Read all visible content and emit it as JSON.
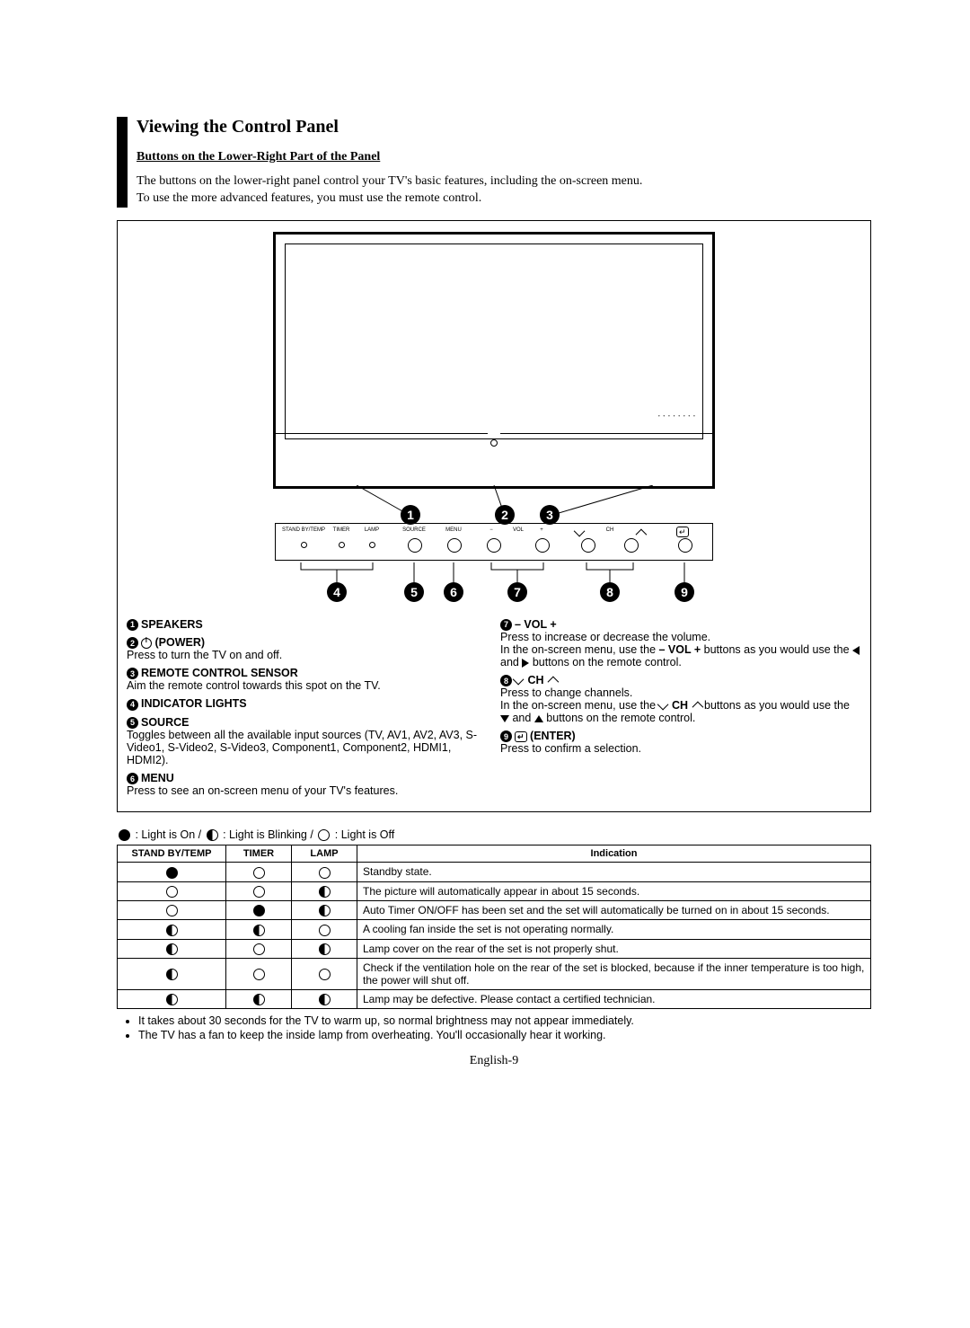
{
  "title": "Viewing the Control Panel",
  "subtitle": "Buttons on the Lower-Right Part of the Panel",
  "intro_line1": "The buttons on the lower-right panel control your TV's basic features, including the on-screen menu.",
  "intro_line2": "To use the more advanced features, you must use the remote control.",
  "panel_labels": {
    "standby": "STAND BY/TEMP",
    "timer": "TIMER",
    "lamp": "LAMP",
    "source": "SOURCE",
    "menu": "MENU",
    "vol_minus": "−",
    "vol_label": "VOL",
    "vol_plus": "+",
    "ch_label": "CH",
    "enter": ""
  },
  "items_left": [
    {
      "n": "1",
      "head": "SPEAKERS",
      "body": ""
    },
    {
      "n": "2",
      "head": "(POWER)",
      "body": "Press to turn the TV on and off.",
      "has_power_icon": true
    },
    {
      "n": "3",
      "head": "REMOTE CONTROL SENSOR",
      "body": "Aim the remote control towards this spot on the TV."
    },
    {
      "n": "4",
      "head": "INDICATOR LIGHTS",
      "body": ""
    },
    {
      "n": "5",
      "head": "SOURCE",
      "body": "Toggles between all the available input sources (TV, AV1, AV2, AV3, S-Video1, S-Video2, S-Video3, Component1, Component2, HDMI1, HDMI2)."
    },
    {
      "n": "6",
      "head": "MENU",
      "body": "Press to see an on-screen menu of your TV's features."
    }
  ],
  "items_right": [
    {
      "n": "7",
      "head": "– VOL +",
      "body1": "Press to increase or decrease the volume.",
      "body2a": "In the on-screen menu, use the ",
      "body2b_bold": "– VOL +",
      "body2c": " buttons as you would use the ",
      "body2d": " and ",
      "body2e": " buttons on the remote control."
    },
    {
      "n": "8",
      "head": "CH",
      "ch_icons": true,
      "body1": "Press to change channels.",
      "body2a": "In the on-screen menu, use the ",
      "body2b_bold": "CH",
      "body2c": " buttons as you would use the ",
      "body2d": " and ",
      "body2e": " buttons on the remote control."
    },
    {
      "n": "9",
      "head": "(ENTER)",
      "enter_icon": true,
      "body": "Press to confirm a selection."
    }
  ],
  "legend": {
    "on": " : Light is On / ",
    "blink": " : Light is Blinking / ",
    "off": " : Light is Off"
  },
  "table": {
    "h_standby": "STAND BY/TEMP",
    "h_timer": "TIMER",
    "h_lamp": "LAMP",
    "h_ind": "Indication",
    "rows": [
      {
        "s": "on",
        "t": "off",
        "l": "off",
        "text": "Standby state."
      },
      {
        "s": "off",
        "t": "off",
        "l": "blink",
        "text": "The picture will automatically appear in about 15 seconds."
      },
      {
        "s": "off",
        "t": "on",
        "l": "blink",
        "text": "Auto Timer ON/OFF has been set and the set will automatically be turned on in about 15 seconds."
      },
      {
        "s": "blink",
        "t": "blink",
        "l": "off",
        "text": "A cooling fan inside the set is not operating normally."
      },
      {
        "s": "blink",
        "t": "off",
        "l": "blink",
        "text": "Lamp cover on the rear of the set is not properly shut."
      },
      {
        "s": "blink",
        "t": "off",
        "l": "off",
        "text": "Check if the ventilation hole on the rear of the set is blocked, because if the inner temperature is too high, the power will shut off."
      },
      {
        "s": "blink",
        "t": "blink",
        "l": "blink",
        "text": "Lamp may be defective. Please contact a certified technician."
      }
    ]
  },
  "bullets": [
    "It takes about 30 seconds for the TV to warm up, so normal brightness may not appear immediately.",
    "The TV has a fan to keep the inside lamp from overheating. You'll occasionally hear it working."
  ],
  "footer": "English-9"
}
